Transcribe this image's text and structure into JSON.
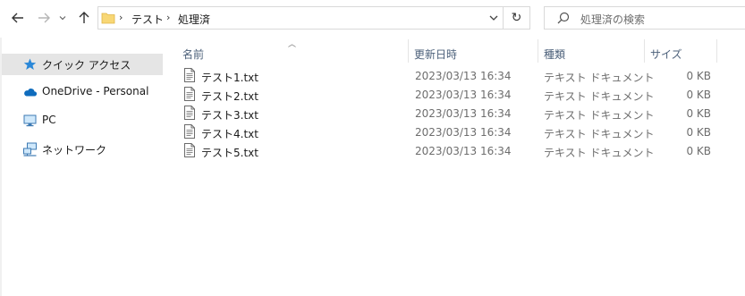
{
  "toolbar": {
    "back_icon": "arrow-left-icon",
    "forward_icon": "arrow-right-icon",
    "recent_icon": "chevron-down-icon",
    "up_icon": "arrow-up-icon"
  },
  "address_bar": {
    "folder_icon": "folder-icon",
    "breadcrumbs": [
      "テスト",
      "処理済"
    ],
    "refresh_icon": "refresh-icon"
  },
  "search": {
    "placeholder": "処理済の検索"
  },
  "sidebar": {
    "items": [
      {
        "label": "クイック アクセス",
        "icon": "star-icon",
        "selected": true
      },
      {
        "label": "OneDrive - Personal",
        "icon": "cloud-icon",
        "selected": false
      },
      {
        "label": "PC",
        "icon": "computer-icon",
        "selected": false
      },
      {
        "label": "ネットワーク",
        "icon": "network-icon",
        "selected": false
      }
    ]
  },
  "file_list": {
    "columns": {
      "name": "名前",
      "modified": "更新日時",
      "type": "種類",
      "size": "サイズ"
    },
    "rows": [
      {
        "name": "テスト1.txt",
        "modified": "2023/03/13 16:34",
        "type": "テキスト ドキュメント",
        "size": "0 KB"
      },
      {
        "name": "テスト2.txt",
        "modified": "2023/03/13 16:34",
        "type": "テキスト ドキュメント",
        "size": "0 KB"
      },
      {
        "name": "テスト3.txt",
        "modified": "2023/03/13 16:34",
        "type": "テキスト ドキュメント",
        "size": "0 KB"
      },
      {
        "name": "テスト4.txt",
        "modified": "2023/03/13 16:34",
        "type": "テキスト ドキュメント",
        "size": "0 KB"
      },
      {
        "name": "テスト5.txt",
        "modified": "2023/03/13 16:34",
        "type": "テキスト ドキュメント",
        "size": "0 KB"
      }
    ]
  },
  "colors": {
    "accent": "#0078d7",
    "header_text": "#4c607a",
    "selected_bg": "#e5e5e5",
    "folder": "#f8d775"
  }
}
